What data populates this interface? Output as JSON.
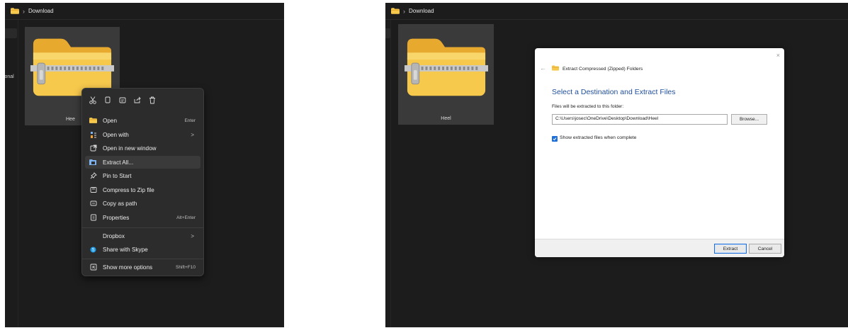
{
  "left": {
    "breadcrumb": {
      "folder": "Download"
    },
    "nav_text": "sonal",
    "file_name": "Hee",
    "context_menu": {
      "icons": [
        "cut-icon",
        "copy-icon",
        "rename-icon",
        "share-icon",
        "delete-icon"
      ],
      "items": [
        {
          "label": "Open",
          "shortcut": "Enter",
          "icon": "folder-icon"
        },
        {
          "label": "Open with",
          "submenu": ">",
          "icon": "open-with-icon"
        },
        {
          "label": "Open in new window",
          "icon": "new-window-icon"
        },
        {
          "label": "Extract All...",
          "icon": "extract-icon",
          "highlighted": true
        },
        {
          "label": "Pin to Start",
          "icon": "pin-icon"
        },
        {
          "label": "Compress to Zip file",
          "icon": "zip-icon"
        },
        {
          "label": "Copy as path",
          "icon": "copy-path-icon"
        },
        {
          "label": "Properties",
          "shortcut": "Alt+Enter",
          "icon": "properties-icon"
        },
        {
          "label": "Dropbox",
          "submenu": ">",
          "icon": ""
        },
        {
          "label": "Share with Skype",
          "icon": "skype-icon"
        },
        {
          "label": "Show more options",
          "shortcut": "Shift+F10",
          "icon": "more-options-icon"
        }
      ]
    }
  },
  "right": {
    "breadcrumb": {
      "folder": "Download"
    },
    "file_name": "Heel",
    "dialog": {
      "close": "×",
      "back": "←",
      "window_title": "Extract Compressed (Zipped) Folders",
      "heading": "Select a Destination and Extract Files",
      "field_label": "Files will be extracted to this folder:",
      "path_value": "C:\\Users\\josec\\OneDrive\\Desktop\\Download\\Heel",
      "browse_label": "Browse...",
      "checkbox_label": "Show extracted files when complete",
      "checkbox_checked": true,
      "extract_label": "Extract",
      "cancel_label": "Cancel"
    }
  },
  "colors": {
    "explorer_bg": "#1c1c1c",
    "menu_bg": "#2c2c2c",
    "accent": "#1e6fd9",
    "heading_blue": "#1f4e9b",
    "folder_yellow": "#f7c948"
  }
}
